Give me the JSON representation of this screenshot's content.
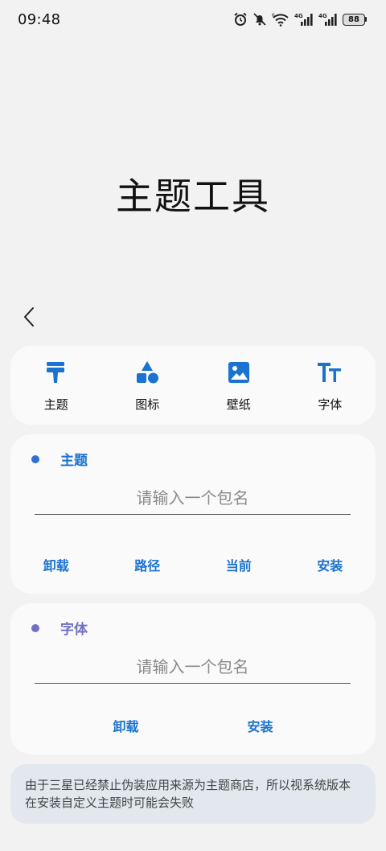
{
  "status": {
    "time": "09:48",
    "battery": "88",
    "network1": "4G",
    "network2": "4G",
    "wifi_badge": "6"
  },
  "title": "主题工具",
  "tabs": [
    {
      "label": "主题",
      "icon": "paint-roller-icon"
    },
    {
      "label": "图标",
      "icon": "shapes-icon"
    },
    {
      "label": "壁纸",
      "icon": "image-icon"
    },
    {
      "label": "字体",
      "icon": "font-icon"
    }
  ],
  "theme_section": {
    "title": "主题",
    "dot_color": "#2f6fd8",
    "title_color": "#1a73d0",
    "placeholder": "请输入一个包名",
    "actions": [
      "卸载",
      "路径",
      "当前",
      "安装"
    ]
  },
  "font_section": {
    "title": "字体",
    "dot_color": "#6f6fc4",
    "title_color": "#6f6fc4",
    "placeholder": "请输入一个包名",
    "actions": [
      "卸载",
      "安装"
    ]
  },
  "notice": "由于三星已经禁止伪装应用来源为主题商店，所以视系统版本在安装自定义主题时可能会失败",
  "colors": {
    "accent": "#1a73d0",
    "background": "#f2f2f2",
    "card": "#fafafa",
    "notice_bg": "#e2e8ee"
  }
}
